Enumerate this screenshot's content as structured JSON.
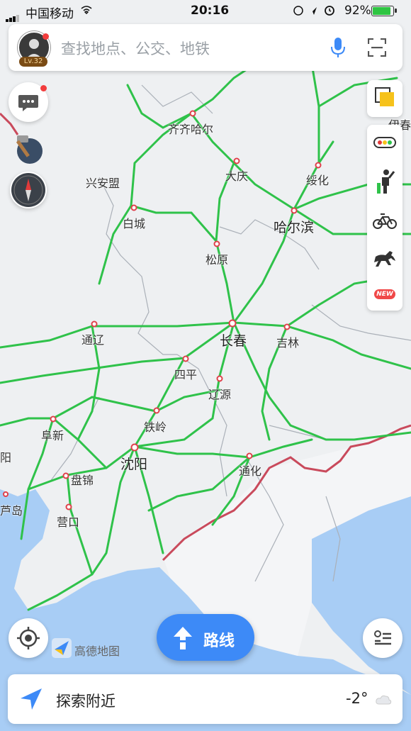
{
  "status_bar": {
    "carrier": "中国移动",
    "time": "20:16",
    "battery_percent": "92%"
  },
  "search": {
    "placeholder": "查找地点、公交、地铁",
    "user_level": "Lv.32"
  },
  "map": {
    "cities": [
      {
        "name": "齐齐哈尔",
        "size": "normal"
      },
      {
        "name": "兴安盟",
        "size": "normal"
      },
      {
        "name": "大庆",
        "size": "normal"
      },
      {
        "name": "绥化",
        "size": "normal"
      },
      {
        "name": "白城",
        "size": "normal"
      },
      {
        "name": "哈尔滨",
        "size": "big"
      },
      {
        "name": "松原",
        "size": "normal"
      },
      {
        "name": "通辽",
        "size": "normal"
      },
      {
        "name": "长春",
        "size": "big"
      },
      {
        "name": "吉林",
        "size": "normal"
      },
      {
        "name": "四平",
        "size": "normal"
      },
      {
        "name": "辽源",
        "size": "normal"
      },
      {
        "name": "阜新",
        "size": "normal"
      },
      {
        "name": "铁岭",
        "size": "normal"
      },
      {
        "name": "沈阳",
        "size": "big"
      },
      {
        "name": "盘锦",
        "size": "normal"
      },
      {
        "name": "通化",
        "size": "normal"
      },
      {
        "name": "营口",
        "size": "normal"
      },
      {
        "name": "芦岛",
        "size": "normal"
      },
      {
        "name": "伊春",
        "size": "normal"
      },
      {
        "name": "阳",
        "size": "normal"
      }
    ]
  },
  "controls": {
    "route_label": "路线",
    "new_badge": "NEW",
    "logo_text": "高德地图"
  },
  "bottom": {
    "explore_label": "探索附近",
    "temperature": "-2°"
  },
  "colors": {
    "road": "#2fc24a",
    "border": "#c94a5c",
    "water": "#a8cdf5",
    "accent": "#3d8af7"
  }
}
